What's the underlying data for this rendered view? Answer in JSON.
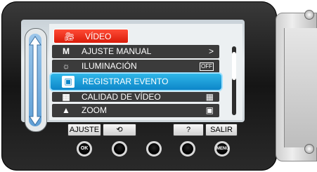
{
  "menu_title": "VÍDEO",
  "menu_items": [
    {
      "label": "AJUSTE MANUAL",
      "icon": "M",
      "right": ">"
    },
    {
      "label": "ILUMINACIÓN",
      "icon": "☼",
      "right": "OFF"
    },
    {
      "label": "REGISTRAR EVENTO",
      "icon": "▣",
      "right": ""
    },
    {
      "label": "CALIDAD DE VÍDEO",
      "icon": "▦",
      "right": "▦"
    },
    {
      "label": "ZOOM",
      "icon": "▲",
      "right": "▣"
    }
  ],
  "softkeys": {
    "ajuste": "AJUSTE",
    "back": "⟲",
    "help": "?",
    "salir": "SALIR"
  },
  "round_buttons": {
    "ok": "OK",
    "menu": "MENU"
  },
  "colors": {
    "title_red": "#e8270f",
    "selection_blue": "#1a9edc",
    "row_dark": "#3b3b3b"
  }
}
